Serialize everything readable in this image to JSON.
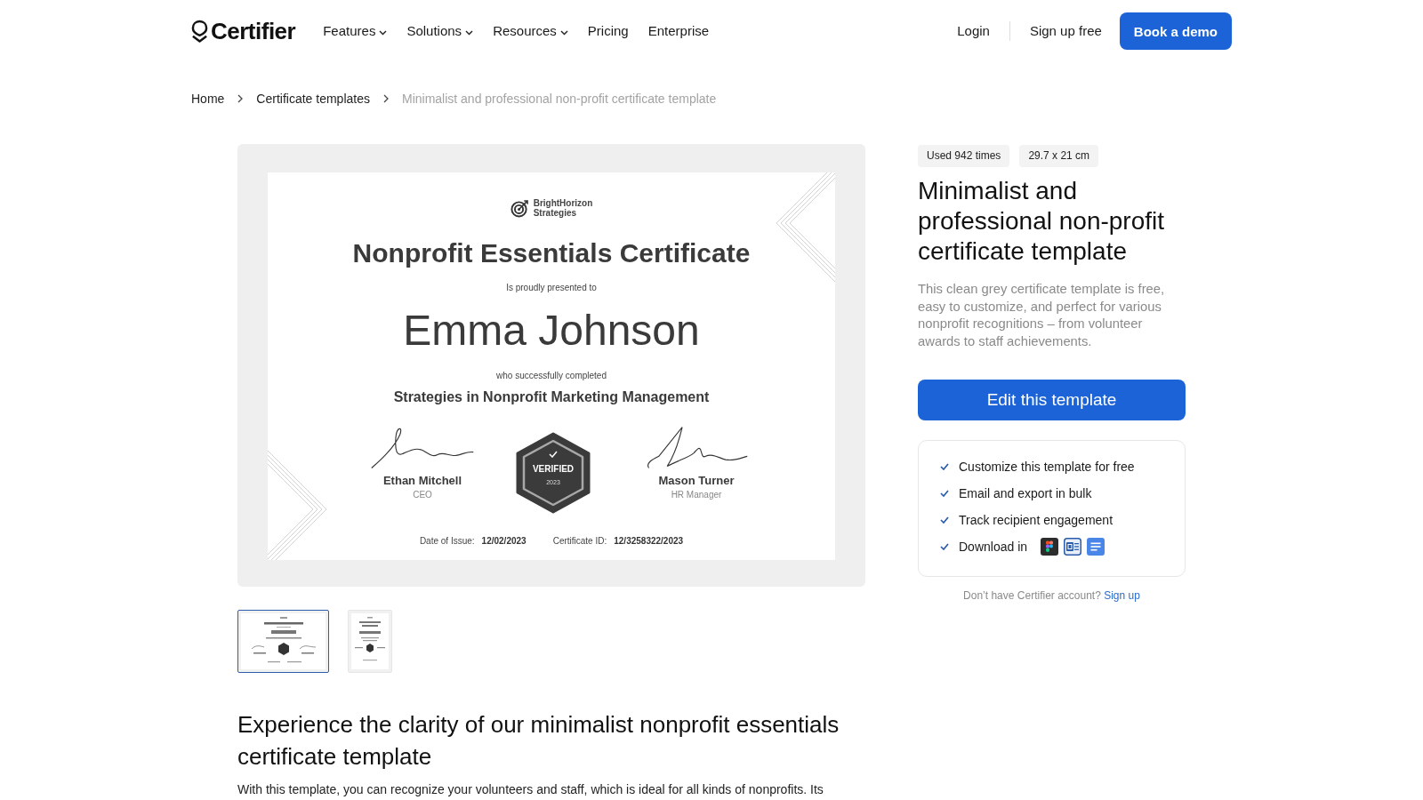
{
  "header": {
    "logo": "Certifier",
    "nav": [
      {
        "label": "Features",
        "dropdown": true
      },
      {
        "label": "Solutions",
        "dropdown": true
      },
      {
        "label": "Resources",
        "dropdown": true
      },
      {
        "label": "Pricing",
        "dropdown": false
      },
      {
        "label": "Enterprise",
        "dropdown": false
      }
    ],
    "login": "Login",
    "signup": "Sign up free",
    "demo": "Book a demo"
  },
  "breadcrumb": [
    {
      "label": "Home",
      "current": false
    },
    {
      "label": "Certificate templates",
      "current": false
    },
    {
      "label": "Minimalist and professional non-profit certificate template",
      "current": true
    }
  ],
  "preview": {
    "certificate": {
      "organization": "BrightHorizon Strategies",
      "title": "Nonprofit Essentials Certificate",
      "intro": "Is proudly presented to",
      "recipient": "Emma Johnson",
      "completed_text": "who successfully completed",
      "course": "Strategies in Nonprofit Marketing Management",
      "signatories": [
        {
          "name": "Ethan Mitchell",
          "role": "CEO"
        },
        {
          "name": "Mason Turner",
          "role": "HR Manager"
        }
      ],
      "badge": {
        "label": "VERIFIED",
        "year": "2023"
      },
      "details": [
        {
          "label": "Date of Issue:",
          "value": "12/02/2023"
        },
        {
          "label": "Certificate ID:",
          "value": "12/3258322/2023"
        }
      ]
    },
    "thumbnails": [
      {
        "kind": "landscape",
        "selected": true
      },
      {
        "kind": "portrait",
        "selected": false
      }
    ]
  },
  "details": {
    "tags": [
      "Used 942 times",
      "29.7 x 21 cm"
    ],
    "title": "Minimalist and professional non-profit certificate template",
    "description": "This clean grey certificate template is free, easy to customize, and perfect for various nonprofit recognitions – from volunteer awards to staff achievements.",
    "cta": "Edit this template",
    "features": [
      {
        "label": "Customize this template for free"
      },
      {
        "label": "Email and export in bulk"
      },
      {
        "label": "Track recipient engagement"
      },
      {
        "label": "Download in",
        "formats": [
          {
            "kind": "design"
          },
          {
            "kind": "word"
          },
          {
            "kind": "doc"
          }
        ]
      }
    ],
    "account_prompt": "Don’t have Certifier account?",
    "signup_link": "Sign up"
  },
  "article": {
    "heading": "Experience the clarity of our minimalist nonprofit essentials certificate template",
    "body": "With this template, you can recognize your volunteers and staff, which is ideal for all kinds of nonprofits. Its"
  }
}
